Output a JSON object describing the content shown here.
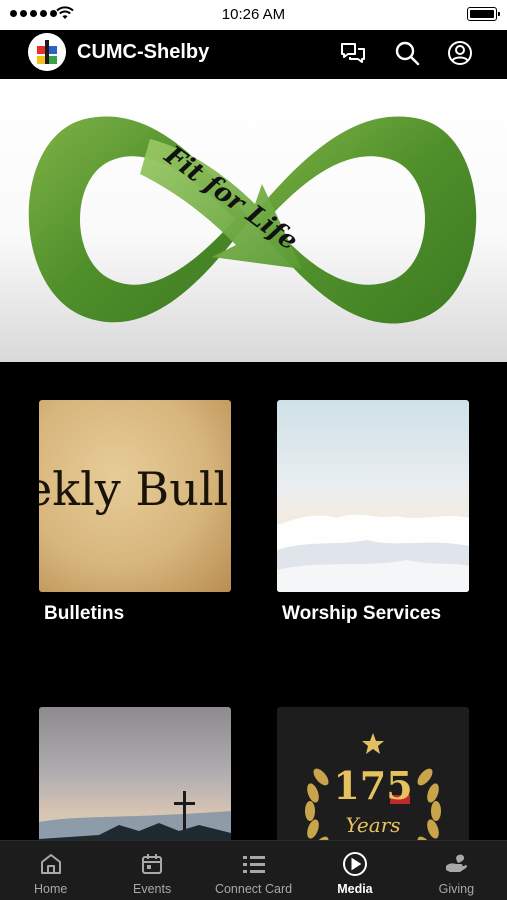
{
  "status_bar": {
    "time": "10:26 AM",
    "signal_icon": "signal-dots-icon",
    "wifi_icon": "wifi-icon",
    "battery_icon": "battery-icon"
  },
  "header": {
    "title": "CUMC-Shelby",
    "logo_icon": "church-logo-icon",
    "actions": [
      "chat-icon",
      "search-icon",
      "profile-icon"
    ]
  },
  "hero": {
    "text": "Fit for Life",
    "image": "green-infinity-symbol"
  },
  "tiles": [
    {
      "label": "Bulletins",
      "image_text": "ekly Bull"
    },
    {
      "label": "Worship Services"
    },
    {
      "label": ""
    },
    {
      "label": "",
      "badge_number": "175",
      "badge_word": "Years"
    }
  ],
  "tabs": [
    {
      "label": "Home",
      "icon": "home-icon"
    },
    {
      "label": "Events",
      "icon": "calendar-icon"
    },
    {
      "label": "Connect Card",
      "icon": "list-icon"
    },
    {
      "label": "Media",
      "icon": "play-circle-icon",
      "active": true
    },
    {
      "label": "Giving",
      "icon": "giving-hand-icon"
    }
  ]
}
